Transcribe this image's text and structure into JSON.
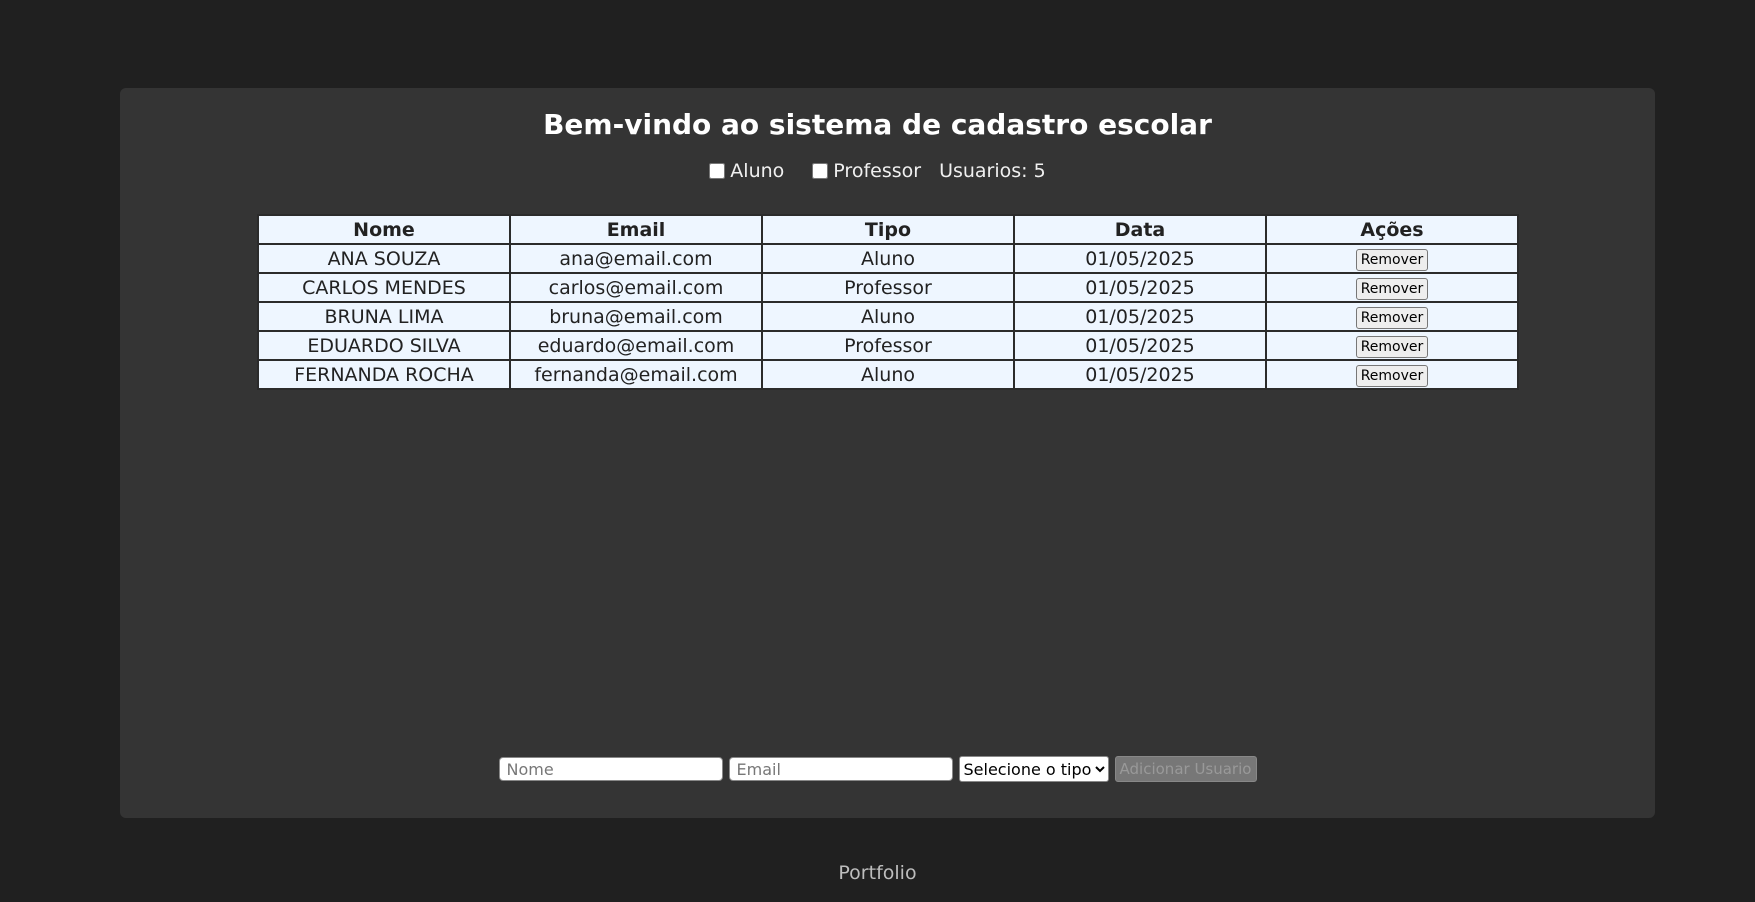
{
  "header": {
    "title": "Bem-vindo ao sistema de cadastro escolar"
  },
  "filters": {
    "aluno_label": "Aluno",
    "professor_label": "Professor",
    "count_text": "Usuarios: 5"
  },
  "table": {
    "columns": [
      "Nome",
      "Email",
      "Tipo",
      "Data",
      "Ações"
    ],
    "rows": [
      {
        "nome": "ANA SOUZA",
        "email": "ana@email.com",
        "tipo": "Aluno",
        "data": "01/05/2025",
        "acao": "Remover"
      },
      {
        "nome": "CARLOS MENDES",
        "email": "carlos@email.com",
        "tipo": "Professor",
        "data": "01/05/2025",
        "acao": "Remover"
      },
      {
        "nome": "BRUNA LIMA",
        "email": "bruna@email.com",
        "tipo": "Aluno",
        "data": "01/05/2025",
        "acao": "Remover"
      },
      {
        "nome": "EDUARDO SILVA",
        "email": "eduardo@email.com",
        "tipo": "Professor",
        "data": "01/05/2025",
        "acao": "Remover"
      },
      {
        "nome": "FERNANDA ROCHA",
        "email": "fernanda@email.com",
        "tipo": "Aluno",
        "data": "01/05/2025",
        "acao": "Remover"
      }
    ]
  },
  "form": {
    "nome_placeholder": "Nome",
    "nome_value": "",
    "email_placeholder": "Email",
    "email_value": "",
    "tipo_selected": "Selecione o tipo",
    "submit_label": "Adicionar Usuario"
  },
  "footer": {
    "link_text": "Portfolio"
  },
  "colors": {
    "page_bg": "#202020",
    "card_bg": "#343434",
    "cell_bg": "#eef6ff"
  }
}
